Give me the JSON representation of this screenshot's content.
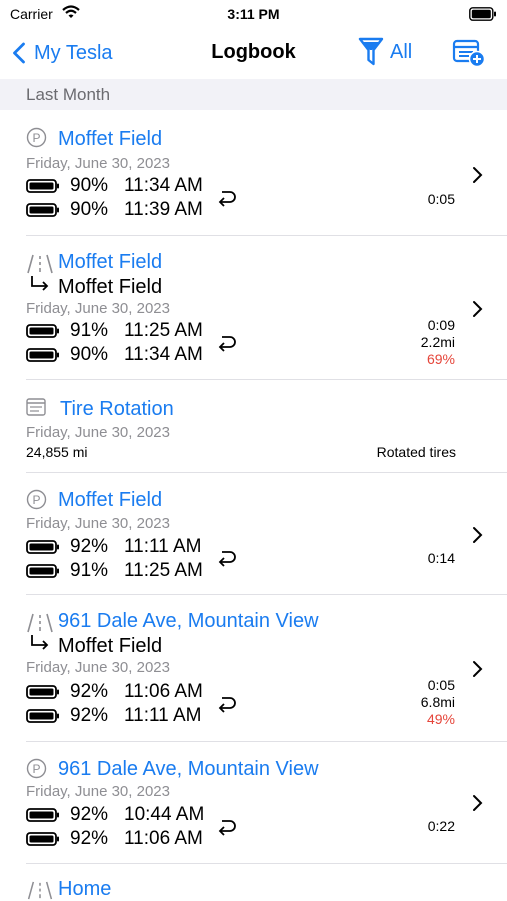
{
  "status": {
    "carrier": "Carrier",
    "time": "3:11 PM"
  },
  "nav": {
    "back_label": "My Tesla",
    "title": "Logbook",
    "filter_label": "All"
  },
  "section": {
    "title": "Last Month"
  },
  "entries": [
    {
      "type": "parked",
      "title": "Moffet Field",
      "date": "Friday, June 30, 2023",
      "start_pct": "90%",
      "start_time": "11:34 AM",
      "end_pct": "90%",
      "end_time": "11:39 AM",
      "duration": "0:05"
    },
    {
      "type": "drive",
      "title": "Moffet Field",
      "destination": "Moffet Field",
      "date": "Friday, June 30, 2023",
      "start_pct": "91%",
      "start_time": "11:25 AM",
      "end_pct": "90%",
      "end_time": "11:34 AM",
      "duration": "0:09",
      "distance": "2.2mi",
      "efficiency": "69%"
    },
    {
      "type": "service",
      "title": "Tire Rotation",
      "date": "Friday, June 30, 2023",
      "odometer": "24,855 mi",
      "note": "Rotated tires"
    },
    {
      "type": "parked",
      "title": "Moffet Field",
      "date": "Friday, June 30, 2023",
      "start_pct": "92%",
      "start_time": "11:11 AM",
      "end_pct": "91%",
      "end_time": "11:25 AM",
      "duration": "0:14"
    },
    {
      "type": "drive",
      "title": "961 Dale Ave, Mountain View",
      "destination": "Moffet Field",
      "date": "Friday, June 30, 2023",
      "start_pct": "92%",
      "start_time": "11:06 AM",
      "end_pct": "92%",
      "end_time": "11:11 AM",
      "duration": "0:05",
      "distance": "6.8mi",
      "efficiency": "49%"
    },
    {
      "type": "parked",
      "title": "961 Dale Ave, Mountain View",
      "date": "Friday, June 30, 2023",
      "start_pct": "92%",
      "start_time": "10:44 AM",
      "end_pct": "92%",
      "end_time": "11:06 AM",
      "duration": "0:22"
    },
    {
      "type": "drive",
      "title": "Home"
    }
  ],
  "colors": {
    "accent": "#1a7cf0",
    "efficiency_red": "#e5453a",
    "secondary_text": "#8e8e93",
    "section_bg": "#f2f2f7"
  },
  "icons": {
    "parked": "parking-icon",
    "drive": "road-icon",
    "service": "note-icon",
    "battery": "battery-icon",
    "loop": "return-arrow-icon",
    "chevron": "chevron-right-icon"
  }
}
